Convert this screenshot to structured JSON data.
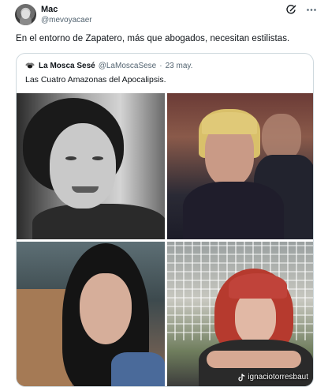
{
  "tweet": {
    "author_name": "Mac",
    "author_handle": "@mevoyacaer",
    "text": "En el entorno de Zapatero, más que abogados, necesitan estilistas."
  },
  "quoted_tweet": {
    "author_name": "La Mosca Sesé",
    "author_handle": "@LaMoscaSese",
    "separator": "·",
    "date": "23 may.",
    "text": "Las Cuatro Amazonas del Apocalipsis.",
    "watermark": "ignaciotorresbaut"
  },
  "icons": {
    "grok": "grok-icon",
    "more": "more-icon",
    "tiktok": "tiktok-icon",
    "fly": "fly-icon"
  },
  "colors": {
    "text": "#0f1419",
    "secondary": "#536471",
    "border": "#cfd9de"
  }
}
